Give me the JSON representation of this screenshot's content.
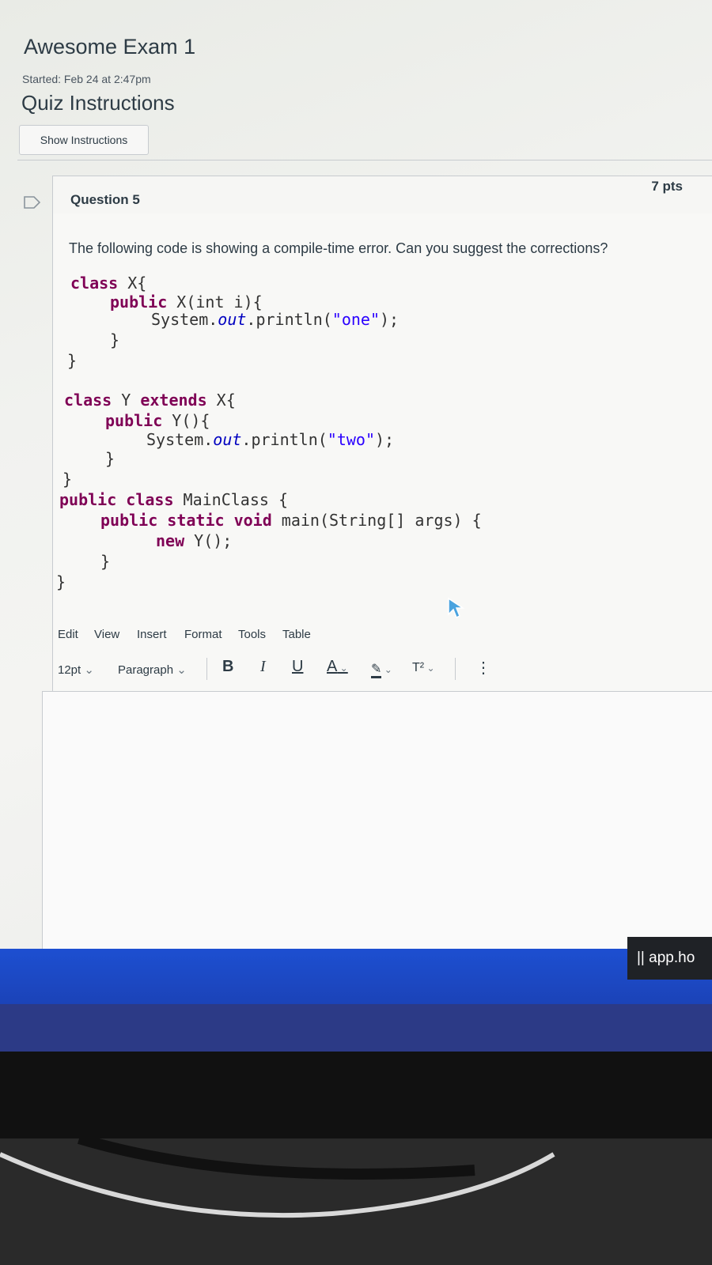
{
  "page": {
    "exam_title": "Awesome Exam 1",
    "started": "Started: Feb 24 at 2:47pm",
    "instructions_heading": "Quiz Instructions",
    "show_instructions_label": "Show Instructions"
  },
  "question": {
    "title": "Question 5",
    "points": "7 pts",
    "text": "The following code is showing a compile-time error. Can you suggest the corrections?",
    "code": {
      "l1_kw": "class",
      "l1_rest": " X{",
      "l2_kw": "public",
      "l2_rest": " X(int i){",
      "l3_a": "System.",
      "l3_field": "out",
      "l3_b": ".println(",
      "l3_str": "\"one\"",
      "l3_c": ");",
      "l4": "}",
      "l5": "}",
      "l6_kw1": "class",
      "l6_mid": " Y ",
      "l6_kw2": "extends",
      "l6_rest": " X{",
      "l7_kw": "public",
      "l7_rest": " Y(){",
      "l8_a": "System.",
      "l8_field": "out",
      "l8_b": ".println(",
      "l8_str": "\"two\"",
      "l8_c": ");",
      "l9": "}",
      "l10": "}",
      "l11_kw1": "public",
      "l11_sp1": " ",
      "l11_kw2": "class",
      "l11_rest": " MainClass {",
      "l12_kw1": "public",
      "l12_sp1": " ",
      "l12_kw2": "static",
      "l12_sp2": " ",
      "l12_kw3": "void",
      "l12_rest": " main(String[] args) {",
      "l13_kw": "new",
      "l13_rest": " Y();",
      "l14": "}",
      "l15": "}"
    }
  },
  "editor": {
    "menu": [
      "Edit",
      "View",
      "Insert",
      "Format",
      "Tools",
      "Table"
    ],
    "font_size": "12pt",
    "block_format": "Paragraph",
    "bold": "B",
    "italic": "I",
    "underline": "U",
    "text_color": "A",
    "superscript": "T²",
    "more": "⋮",
    "answer_value": ""
  },
  "taskbar": {
    "app_label": "|| app.ho"
  },
  "colors": {
    "accent_blue": "#1d4fd1",
    "text_dark": "#2d3b45",
    "keyword": "#7f0055"
  }
}
